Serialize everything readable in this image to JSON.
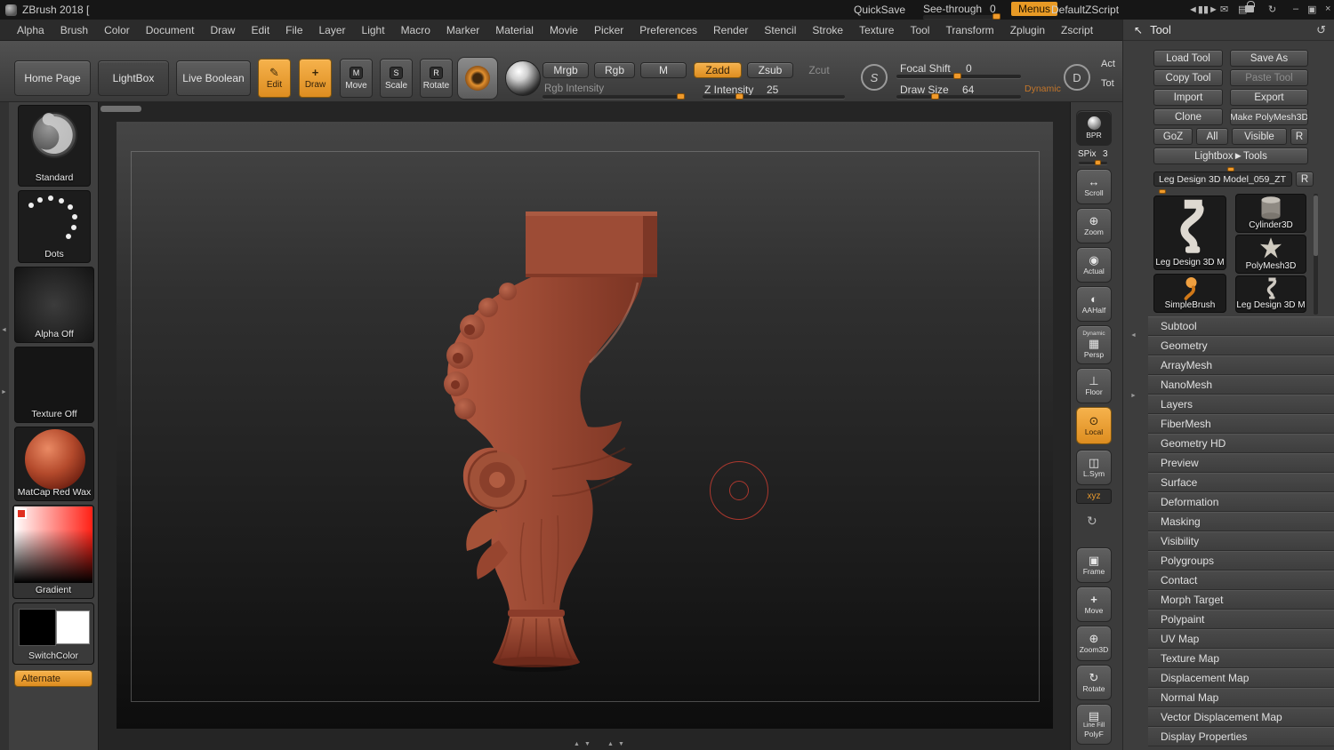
{
  "colors": {
    "accent_orange": "#ee9c2d",
    "model_red": "#9a4b36",
    "cursor_red": "#c23a2e"
  },
  "title_bar": {
    "app_title": "ZBrush 2018 [",
    "quicksave_label": "QuickSave",
    "see_through_label": "See-through",
    "see_through_value": "0",
    "menus_label": "Menus",
    "zscript_label": "DefaultZScript"
  },
  "menu_bar": {
    "items": [
      "Alpha",
      "Brush",
      "Color",
      "Document",
      "Draw",
      "Edit",
      "File",
      "Layer",
      "Light",
      "Macro",
      "Marker",
      "Material",
      "Movie",
      "Picker",
      "Preferences",
      "Render",
      "Stencil",
      "Stroke",
      "Texture",
      "Tool",
      "Transform",
      "Zplugin",
      "Zscript"
    ]
  },
  "toolbar": {
    "home_page": "Home Page",
    "lightbox": "LightBox",
    "live_boolean": "Live Boolean",
    "edit": "Edit",
    "draw": "Draw",
    "move": "Move",
    "scale": "Scale",
    "rotate": "Rotate",
    "move_badge": "M",
    "scale_badge": "S",
    "rotate_badge": "R",
    "mrgb": "Mrgb",
    "rgb": "Rgb",
    "m": "M",
    "zadd": "Zadd",
    "zsub": "Zsub",
    "zcut": "Zcut",
    "rgb_intensity_label": "Rgb Intensity",
    "z_intensity_label": "Z Intensity",
    "z_intensity_value": "25",
    "focal_shift_label": "Focal Shift",
    "focal_shift_value": "0",
    "draw_size_label": "Draw Size",
    "draw_size_value": "64",
    "dynamic_label": "Dynamic",
    "act": "Act",
    "tot": "Tot",
    "sphere_s": "S",
    "sphere_d": "D"
  },
  "left_sidebar": {
    "brush_label": "Standard",
    "stroke_label": "Dots",
    "alpha_label": "Alpha Off",
    "texture_label": "Texture Off",
    "material_label": "MatCap Red Wax",
    "gradient_label": "Gradient",
    "switch_label": "SwitchColor",
    "alternate_label": "Alternate"
  },
  "right_strip": {
    "bpr": "BPR",
    "spix_label": "SPix",
    "spix_value": "3",
    "scroll": "Scroll",
    "zoom": "Zoom",
    "actual": "Actual",
    "aahalf": "AAHalf",
    "dynamic": "Dynamic",
    "persp": "Persp",
    "floor": "Floor",
    "local": "Local",
    "lsym": "L.Sym",
    "xyz": "xyz",
    "frame": "Frame",
    "move": "Move",
    "zoom3d": "Zoom3D",
    "rotate": "Rotate",
    "line_fill": "Line Fill",
    "polyf": "PolyF"
  },
  "tool_panel": {
    "header": "Tool",
    "load_tool": "Load Tool",
    "save_as": "Save As",
    "copy_tool": "Copy Tool",
    "paste_tool": "Paste Tool",
    "import": "Import",
    "export": "Export",
    "clone": "Clone",
    "make_polymesh3d": "Make PolyMesh3D",
    "goz": "GoZ",
    "all": "All",
    "visible": "Visible",
    "r_badge": "R",
    "lightbox_tools": "Lightbox►Tools",
    "active_tool_name": "Leg Design 3D Model_059_ZT",
    "rename_badge": "R",
    "thumbnails": [
      {
        "label": "Leg Design 3D M"
      },
      {
        "label": "Cylinder3D"
      },
      {
        "label": "PolyMesh3D"
      },
      {
        "label": "SimpleBrush"
      },
      {
        "label": "Leg Design 3D M"
      }
    ],
    "sections": [
      "Subtool",
      "Geometry",
      "ArrayMesh",
      "NanoMesh",
      "Layers",
      "FiberMesh",
      "Geometry HD",
      "Preview",
      "Surface",
      "Deformation",
      "Masking",
      "Visibility",
      "Polygroups",
      "Contact",
      "Morph Target",
      "Polypaint",
      "UV Map",
      "Texture Map",
      "Displacement Map",
      "Normal Map",
      "Vector Displacement Map",
      "Display Properties"
    ]
  }
}
